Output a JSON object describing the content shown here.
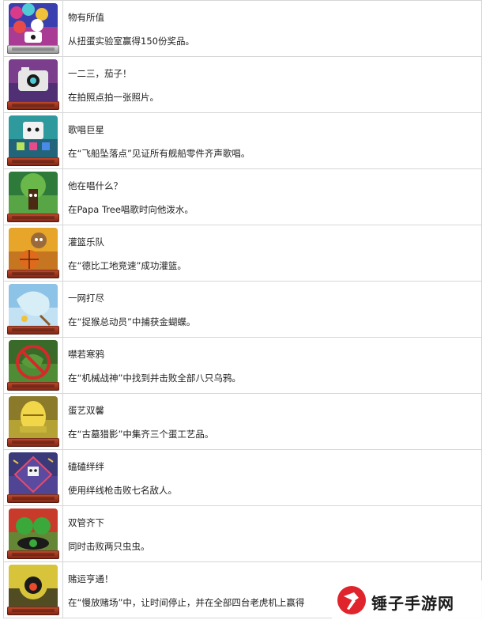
{
  "achievements": [
    {
      "title": "物有所值",
      "description": "从扭蛋实验室赢得150份奖品。",
      "icon": "capsule-prizes-icon",
      "base": "silver",
      "colors": [
        "#3a3fb0",
        "#d93a8a",
        "#4ecbd6"
      ]
    },
    {
      "title": "一二三，茄子！",
      "description": "在拍照点拍一张照片。",
      "icon": "camera-robot-icon",
      "base": "bronze",
      "colors": [
        "#7a3e8c",
        "#3e2a6a",
        "#e6e6e6"
      ]
    },
    {
      "title": "歌唱巨星",
      "description": "在“飞船坠落点”见证所有舰船零件齐声歌唱。",
      "icon": "singing-robot-icon",
      "base": "bronze",
      "colors": [
        "#2e9a9e",
        "#1e4d6a",
        "#b8e35a"
      ]
    },
    {
      "title": "他在唱什么？",
      "description": "在Papa Tree唱歌时向他泼水。",
      "icon": "papa-tree-icon",
      "base": "bronze",
      "colors": [
        "#2e7a3a",
        "#6ab84a",
        "#4a2a12"
      ]
    },
    {
      "title": "灌篮乐队",
      "description": "在“德比工地竞速”成功灌篮。",
      "icon": "basketball-monkey-icon",
      "base": "bronze",
      "colors": [
        "#e7a52a",
        "#b8621c",
        "#f0d060"
      ]
    },
    {
      "title": "一网打尽",
      "description": "在“捉猴总动员”中捕获金蝴蝶。",
      "icon": "butterfly-net-icon",
      "base": "bronze",
      "colors": [
        "#8ec3e8",
        "#d8eef7",
        "#6ab84a"
      ]
    },
    {
      "title": "噤若寒鸦",
      "description": "在“机械战神”中找到并击败全部八只乌鸦。",
      "icon": "no-crow-icon",
      "base": "bronze",
      "colors": [
        "#3a6a2a",
        "#5a9a3a",
        "#d42a2a"
      ]
    },
    {
      "title": "蛋艺双馨",
      "description": "在“古墓猎影”中集齐三个蛋工艺品。",
      "icon": "golden-egg-icon",
      "base": "bronze",
      "colors": [
        "#8a7a2a",
        "#c8b43a",
        "#f2d64a"
      ]
    },
    {
      "title": "磕磕绊绊",
      "description": "使用绊线枪击败七名敌人。",
      "icon": "tripwire-robot-icon",
      "base": "bronze",
      "colors": [
        "#3a3a7a",
        "#5a4aa0",
        "#e8c04a"
      ]
    },
    {
      "title": "双管齐下",
      "description": "同时击败两只虫虫。",
      "icon": "twin-frogs-icon",
      "base": "bronze",
      "colors": [
        "#c83a2a",
        "#3aa83a",
        "#1a1a1a"
      ]
    },
    {
      "title": "赌运亨通！",
      "description": "在“慢放赌场”中，让时间停止，并在全部四台老虎机上赢得",
      "icon": "slot-jackpot-icon",
      "base": "bronze",
      "colors": [
        "#d8c43a",
        "#1a1a1a",
        "#e84a2a"
      ]
    }
  ],
  "watermark": {
    "text": "锤子手游网",
    "icon": "hammer-logo-icon",
    "colors": [
      "#e0242c",
      "#ffffff"
    ]
  }
}
